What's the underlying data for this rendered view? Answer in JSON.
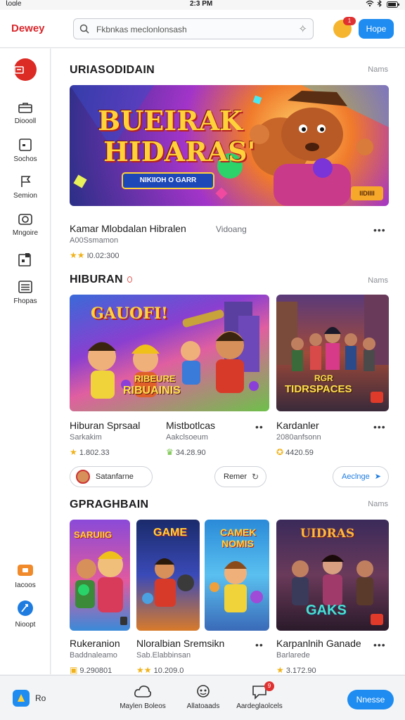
{
  "status_bar": {
    "carrier": "Ꙇoɑle",
    "time": "2:3 PM"
  },
  "header": {
    "brand": "Dewey",
    "search_text": "Fkbnkas meclonlonsash",
    "notification_count": "1",
    "action_button": "Hope"
  },
  "sidebar": {
    "items": [
      {
        "label": "Dioooll",
        "icon": "briefcase-icon"
      },
      {
        "label": "Sochos",
        "icon": "card-icon"
      },
      {
        "label": "Semion",
        "icon": "flag-icon"
      },
      {
        "label": "Mngoire",
        "icon": "camera-icon"
      },
      {
        "label": "",
        "icon": "puzzle-icon"
      },
      {
        "label": "Fhopas",
        "icon": "list-icon"
      },
      {
        "label": "Iacoos",
        "icon": "store-icon"
      },
      {
        "label": "Nioopt",
        "icon": "compass-icon"
      }
    ]
  },
  "featured": {
    "title": "URIASODIDAIN",
    "more": "Nams",
    "banner_title_1": "BUEIRAK",
    "banner_title_2": "HIDARAS'",
    "banner_button": "NIKIIOH O GARR",
    "banner_badge": "IIDIIII",
    "card_title": "Kamar Mlobdalan Hibralen",
    "card_tag": "Vidoang",
    "card_sub": "A00Ssmamon",
    "card_rating": "I0.02:300"
  },
  "hiburan": {
    "title": "HIBURAN",
    "more": "Nams",
    "art_1_title": "GAUOFI!",
    "art_1_sub_1": "RIBEURE",
    "art_1_sub_2": "RIBUAINIS",
    "art_2_title_1": "RGR",
    "art_2_title_2": "TIDRSPACES",
    "cards": [
      {
        "title": "Hiburan Sprsaal",
        "sub": "Sarkakim",
        "rating": "1.802.33"
      },
      {
        "title": "Mistbotlcas",
        "sub": "Aakclsoeum",
        "rating": "34.28.90"
      },
      {
        "title": "Kardanler",
        "sub": "2080anfsonn",
        "rating": "4420.59"
      }
    ],
    "chips": [
      "Satanfarne",
      "Remer",
      "Aeclnge"
    ]
  },
  "graphbain": {
    "title": "GPRAGHBAIN",
    "more": "Nams",
    "art_1_text": "SARUIIG",
    "art_2_text": "GAME",
    "art_3_text_1": "CAMEK",
    "art_3_text_2": "NOMIS",
    "art_4_text_1": "UIDRAS",
    "art_4_text_2": "GAKS",
    "cards": [
      {
        "title": "Rukeranion",
        "sub": "Baddnaleamo",
        "rating": "9.290801"
      },
      {
        "title": "Nloralbian Sremsikn",
        "sub": "Sab.Elabbinsan",
        "rating": "10.209.0"
      },
      {
        "title": "Karpanlnih Ganade",
        "sub": "Barlarede",
        "rating": "3.172.90"
      }
    ]
  },
  "bottom_bar": {
    "logo_text": "Ro",
    "items": [
      {
        "label": "Maylen Boleos",
        "icon": "cloud-icon"
      },
      {
        "label": "Allatoaads",
        "icon": "chat-group-icon"
      },
      {
        "label": "Aardeglaolcels",
        "icon": "notification-chat-icon",
        "badge": "9"
      }
    ],
    "button": "Nnesse"
  },
  "colors": {
    "accent": "#1e8cf0",
    "brand": "#d8262b",
    "star": "#f0b21a"
  }
}
